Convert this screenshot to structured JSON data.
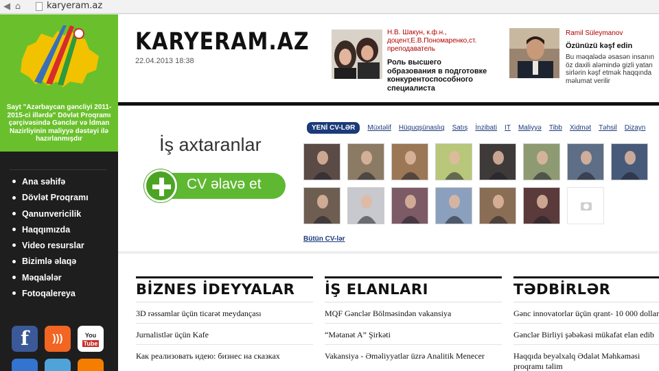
{
  "browser": {
    "url": "karyeram.az",
    "back_icon": "back-arrow-icon",
    "forward_icon": "forward-arrow-icon",
    "reload_icon": "reload-icon",
    "home_icon": "home-icon"
  },
  "sidebar": {
    "logo_caption": "Sayt \"Azərbaycan gəncliyi 2011-2015-ci illərdə\" Dövlət Proqramı çərçivəsində Gənclər və İdman Nazirliyinin maliyyə dəstəyi ilə hazırlanmışdır",
    "menu": [
      "Ana səhifə",
      "Dövlət Proqramı",
      "Qanunvericilik",
      "Haqqımızda",
      "Video resurslar",
      "Bizimlə əlaqə",
      "Məqalələr",
      "Fotoqalereya"
    ],
    "social": [
      {
        "name": "facebook-icon",
        "glyph": "f",
        "color": "#3b5998"
      },
      {
        "name": "rss-icon",
        "glyph": ")))",
        "color": "#f26522"
      },
      {
        "name": "youtube-icon",
        "glyph": "You Tube",
        "color": "#c4302b"
      },
      {
        "name": "delicious-icon",
        "glyph": "",
        "color": "#3274d0"
      },
      {
        "name": "globe-icon",
        "glyph": "",
        "color": "#4fa3d9"
      },
      {
        "name": "blogger-icon",
        "glyph": "",
        "color": "#f57d00"
      }
    ]
  },
  "header": {
    "logo": "KARYERAM.AZ",
    "date": "22.04.2013 18:38",
    "article1": {
      "author": "Н.В. Шакун, к.ф.н., доцент,Е.В.Пономаренко,ст. преподаватель",
      "title": "Роль высшего образования в подготовке конкурентоспособного специалиста"
    },
    "article2": {
      "author": "Ramil Süleymanov",
      "title": "Özünüzü kəşf edin",
      "text": "Bu məqalədə əsasən insanın öz daxili aləmində gizli yatan sirlərin kəşf etmək haqqında məlumat verilir"
    }
  },
  "cv": {
    "seekers_title": "İş axtaranlar",
    "add_button": "CV əlavə et",
    "tabs": [
      "YENİ CV-LƏR",
      "Müxtəlif",
      "Hüquqşünaslıq",
      "Satış",
      "İnzibati",
      "IT",
      "Maliyyə",
      "Tibb",
      "Xidmət",
      "Təhsil",
      "Dizayn"
    ],
    "all_link": "Bütün CV-lər",
    "thumb_colors": [
      "#5a4b46",
      "#8c7b64",
      "#9b7756",
      "#b8c77a",
      "#3f3a3a",
      "#8e9a72",
      "#5e6e86",
      "#475a7a",
      "#6e5e52",
      "#c7c9cf",
      "#7c5a66",
      "#8aa0bd",
      "#8a6d55",
      "#5a3a3a",
      "#ffffff"
    ]
  },
  "news": {
    "columns": [
      {
        "title": "BİZNES İDEYYALAR",
        "items": [
          "3D rəssamlar üçün ticarət meydançası",
          "Jurnalistlər üçün Kafe",
          "Как реализовать идею: бизнес на сказках"
        ]
      },
      {
        "title": "İŞ ELANLARI",
        "items": [
          "MQF Gənclər Bölməsindən vakansiya",
          "“Mətanət A” Şirkəti",
          "Vakansiya - Əməliyyatlar üzrə Analitik Menecer"
        ]
      },
      {
        "title": "TƏDBİRLƏR",
        "items": [
          "Gənc innovatorlar üçün qrant- 10 000 dollar",
          "Gənclər Birliyi şəbəkəsi mükafat elan edib",
          "Haqqıda beyəlxalq Ədalət Məhkəməsi proqramı təlim"
        ]
      }
    ]
  }
}
